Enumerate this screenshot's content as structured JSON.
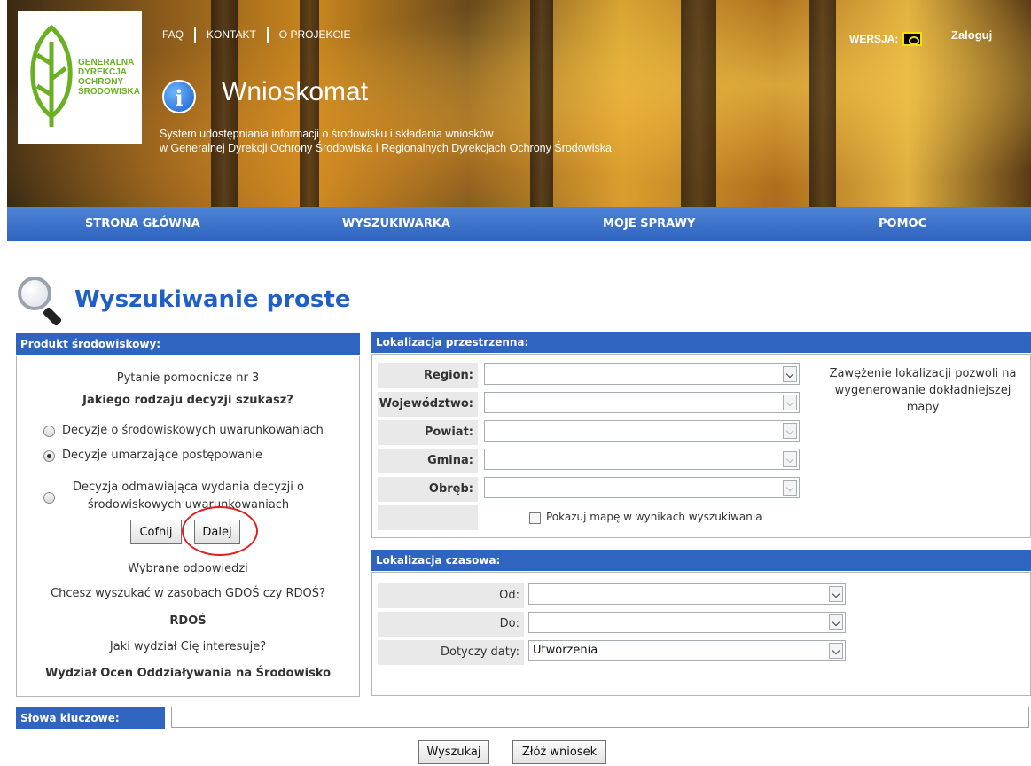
{
  "header": {
    "logo_lines": [
      "GENERALNA",
      "DYREKCJA",
      "OCHRONY",
      "ŚRODOWISKA"
    ],
    "top_links": [
      "FAQ",
      "KONTAKT",
      "O PROJEKCIE"
    ],
    "wersja_label": "WERSJA:",
    "login_label": "Zaloguj",
    "app_title": "Wnioskomat",
    "app_subtitle_1": "System udostępniania informacji o środowisku i składania wniosków",
    "app_subtitle_2": "w Generalnej Dyrekcji Ochrony Środowiska i Regionalnych Dyrekcjach Ochrony Środowiska"
  },
  "nav": [
    "STRONA GŁÓWNA",
    "WYSZUKIWARKA",
    "MOJE SPRAWY",
    "POMOC"
  ],
  "page_title": "Wyszukiwanie proste",
  "product": {
    "heading": "Produkt środowiskowy:",
    "question_number": "Pytanie pomocnicze nr 3",
    "question": "Jakiego rodzaju decyzji szukasz?",
    "options": [
      {
        "label": "Decyzje o środowiskowych uwarunkowaniach",
        "checked": false
      },
      {
        "label": "Decyzje umarzające postępowanie",
        "checked": true
      },
      {
        "label_1": "Decyzja odmawiająca wydania decyzji o",
        "label_2": "środowiskowych uwarunkowaniach",
        "checked": false
      }
    ],
    "back_label": "Cofnij",
    "next_label": "Dalej",
    "answers_heading": "Wybrane odpowiedzi",
    "answers": [
      {
        "q": "Chcesz wyszukać w zasobach GDOŚ czy RDOŚ?",
        "a": "RDOŚ"
      },
      {
        "q": "Jaki wydział Cię interesuje?",
        "a": "Wydział Ocen Oddziaływania na Środowisko"
      }
    ]
  },
  "spatial": {
    "heading": "Lokalizacja przestrzenna:",
    "fields": [
      {
        "label": "Region:",
        "value": "",
        "enabled": true
      },
      {
        "label": "Województwo:",
        "value": "",
        "enabled": false
      },
      {
        "label": "Powiat:",
        "value": "",
        "enabled": false
      },
      {
        "label": "Gmina:",
        "value": "",
        "enabled": false
      },
      {
        "label": "Obręb:",
        "value": "",
        "enabled": false
      }
    ],
    "show_map_label": "Pokazuj mapę w wynikach wyszukiwania",
    "hint": "Zawężenie lokalizacji pozwoli na wygenerowanie dokładniejszej mapy"
  },
  "temporal": {
    "heading": "Lokalizacja czasowa:",
    "from_label": "Od:",
    "from_value": "",
    "to_label": "Do:",
    "to_value": "",
    "date_label": "Dotyczy daty:",
    "date_value": "Utworzenia"
  },
  "keywords": {
    "label": "Słowa kluczowe:",
    "value": ""
  },
  "actions": {
    "search_label": "Wyszukaj",
    "submit_label": "Złóż wniosek"
  }
}
